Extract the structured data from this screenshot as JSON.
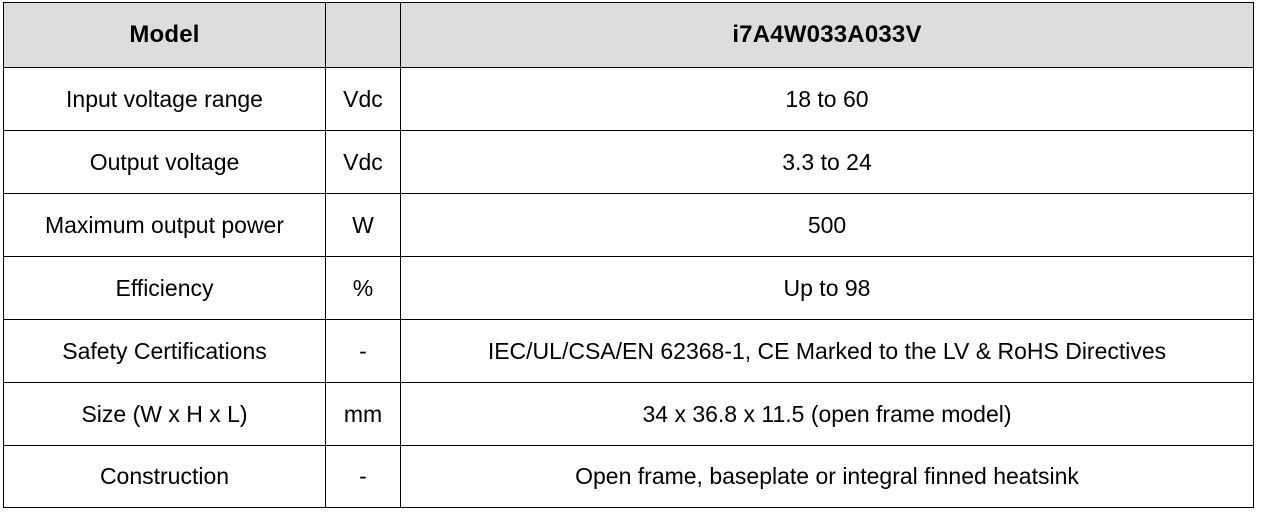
{
  "table": {
    "header": {
      "param_label": "Model",
      "unit_label": "",
      "value_label": "i7A4W033A033V"
    },
    "rows": [
      {
        "parameter": "Input voltage range",
        "unit": "Vdc",
        "value": "18 to 60"
      },
      {
        "parameter": "Output voltage",
        "unit": "Vdc",
        "value": "3.3 to 24"
      },
      {
        "parameter": "Maximum output power",
        "unit": "W",
        "value": "500"
      },
      {
        "parameter": "Efficiency",
        "unit": "%",
        "value": "Up to 98"
      },
      {
        "parameter": "Safety Certifications",
        "unit": "-",
        "value": "IEC/UL/CSA/EN 62368-1, CE Marked to the LV & RoHS Directives"
      },
      {
        "parameter": "Size (W x H x L)",
        "unit": "mm",
        "value": "34 x 36.8 x 11.5 (open frame model)"
      },
      {
        "parameter": "Construction",
        "unit": "-",
        "value": "Open frame, baseplate or integral finned heatsink"
      }
    ]
  },
  "colors": {
    "header_background": "#dddddd",
    "border": "#000000",
    "text": "#000000",
    "cell_background": "#ffffff"
  }
}
